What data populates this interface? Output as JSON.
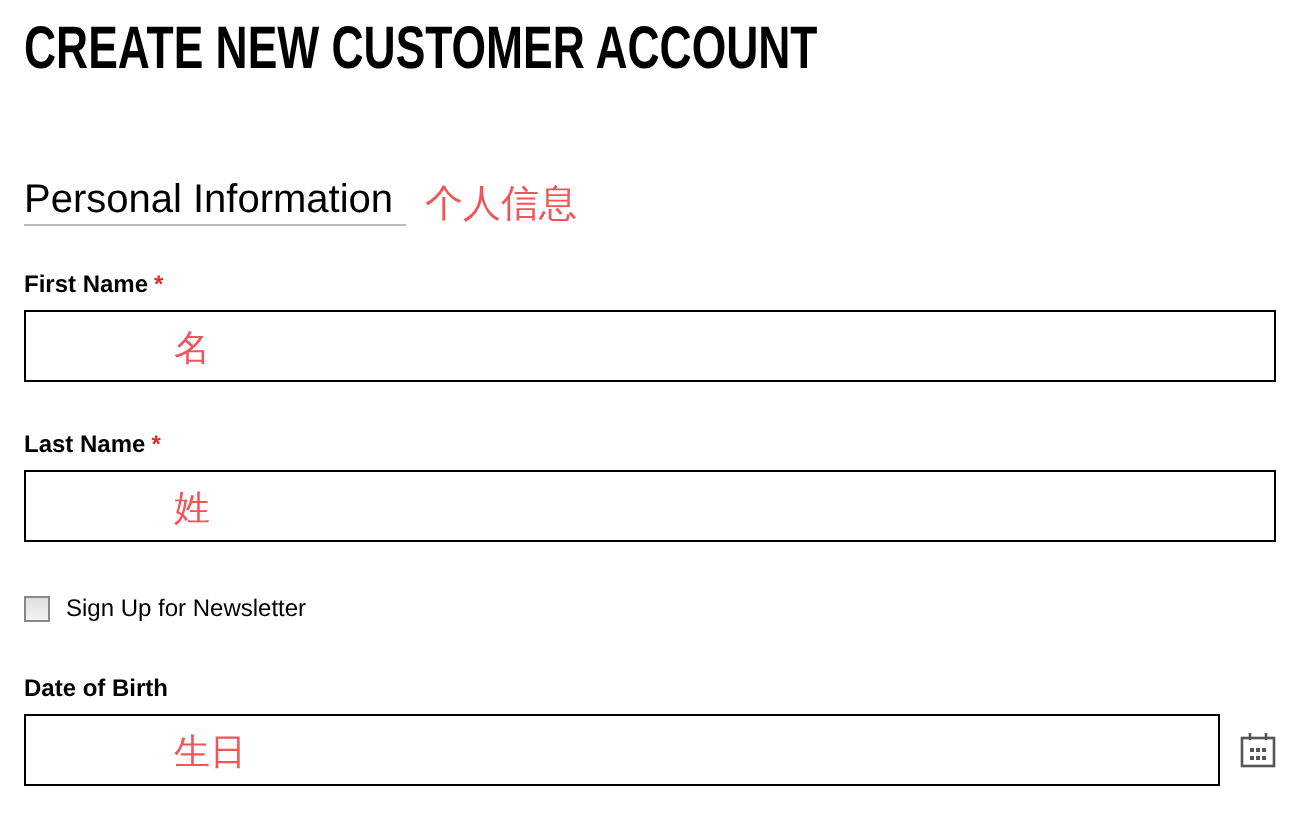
{
  "title": "CREATE NEW CUSTOMER ACCOUNT",
  "section": {
    "heading": "Personal Information",
    "annotation": "个人信息"
  },
  "fields": [
    {
      "kind": "text",
      "label": "First Name",
      "required_mark": "*",
      "annotation": "名"
    },
    {
      "kind": "text",
      "label": "Last Name",
      "required_mark": "*",
      "annotation": "姓"
    },
    {
      "kind": "checkbox",
      "label": "Sign Up for Newsletter",
      "checked": false
    },
    {
      "kind": "date",
      "label": "Date of Birth",
      "annotation": "生日"
    }
  ]
}
